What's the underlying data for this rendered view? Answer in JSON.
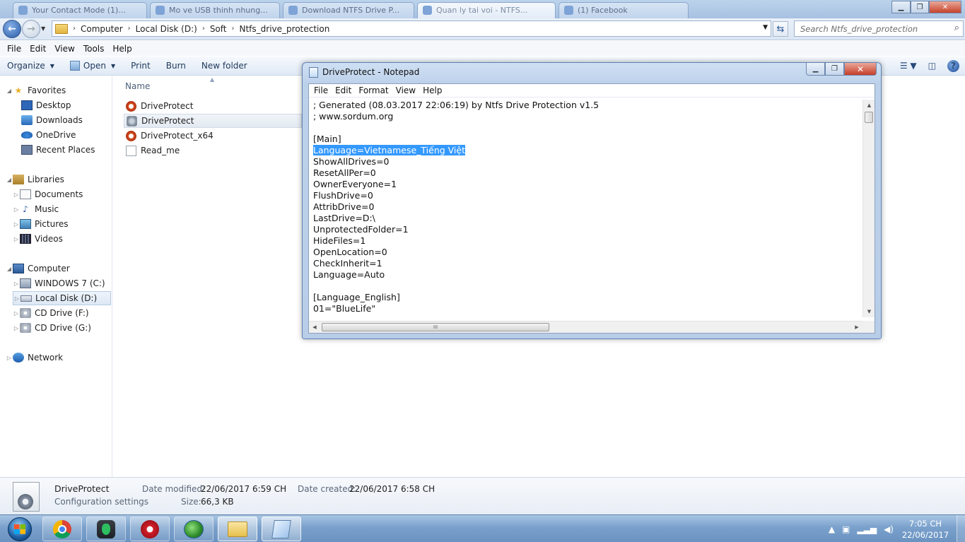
{
  "browser_tabs": [
    {
      "label": "Your Contact Mode (1)..."
    },
    {
      "label": "Mo ve USB thinh nhung..."
    },
    {
      "label": "Download NTFS Drive P..."
    },
    {
      "label": "Quan ly tai voi - NTFS..."
    },
    {
      "label": "(1) Facebook"
    }
  ],
  "explorer": {
    "breadcrumb": [
      "Computer",
      "Local Disk (D:)",
      "Soft",
      "Ntfs_drive_protection"
    ],
    "search_placeholder": "Search Ntfs_drive_protection",
    "menu": [
      "File",
      "Edit",
      "View",
      "Tools",
      "Help"
    ],
    "commands": {
      "organize": "Organize",
      "open": "Open",
      "print": "Print",
      "burn": "Burn",
      "new_folder": "New folder"
    },
    "nav": {
      "favorites": "Favorites",
      "desktop": "Desktop",
      "downloads": "Downloads",
      "onedrive": "OneDrive",
      "recent": "Recent Places",
      "libraries": "Libraries",
      "documents": "Documents",
      "music": "Music",
      "pictures": "Pictures",
      "videos": "Videos",
      "computer": "Computer",
      "drive_c": "WINDOWS 7 (C:)",
      "drive_d": "Local Disk (D:)",
      "drive_f": "CD Drive (F:)",
      "drive_g": "CD Drive (G:)",
      "network": "Network"
    },
    "column_header": "Name",
    "files": [
      {
        "name": "DriveProtect",
        "icon": "app-icon"
      },
      {
        "name": "DriveProtect",
        "icon": "config-file-icon"
      },
      {
        "name": "DriveProtect_x64",
        "icon": "app-icon"
      },
      {
        "name": "Read_me",
        "icon": "text-file-icon"
      }
    ],
    "details": {
      "name": "DriveProtect",
      "type": "Configuration settings",
      "modified_label": "Date modified:",
      "modified_value": "22/06/2017 6:59 CH",
      "size_label": "Size:",
      "size_value": "66,3 KB",
      "created_label": "Date created:",
      "created_value": "22/06/2017 6:58 CH"
    }
  },
  "notepad": {
    "title": "DriveProtect - Notepad",
    "menu": [
      "File",
      "Edit",
      "Format",
      "View",
      "Help"
    ],
    "lines": [
      "; Generated (08.03.2017 22:06:19) by Ntfs Drive Protection v1.5",
      "; www.sordum.org",
      "",
      "[Main]",
      "Language=Vietnamese_Tiếng Việt",
      "ShowAllDrives=0",
      "ResetAllPer=0",
      "OwnerEveryone=1",
      "FlushDrive=0",
      "AttribDrive=0",
      "LastDrive=D:\\",
      "UnprotectedFolder=1",
      "HideFiles=1",
      "OpenLocation=0",
      "CheckInherit=1",
      "Language=Auto",
      "",
      "[Language_English]",
      "01=\"BlueLife\""
    ],
    "selected_line": 4,
    "hscroll_marker": "III"
  },
  "taskbar": {
    "clock_time": "7:05 CH",
    "clock_date": "22/06/2017"
  }
}
